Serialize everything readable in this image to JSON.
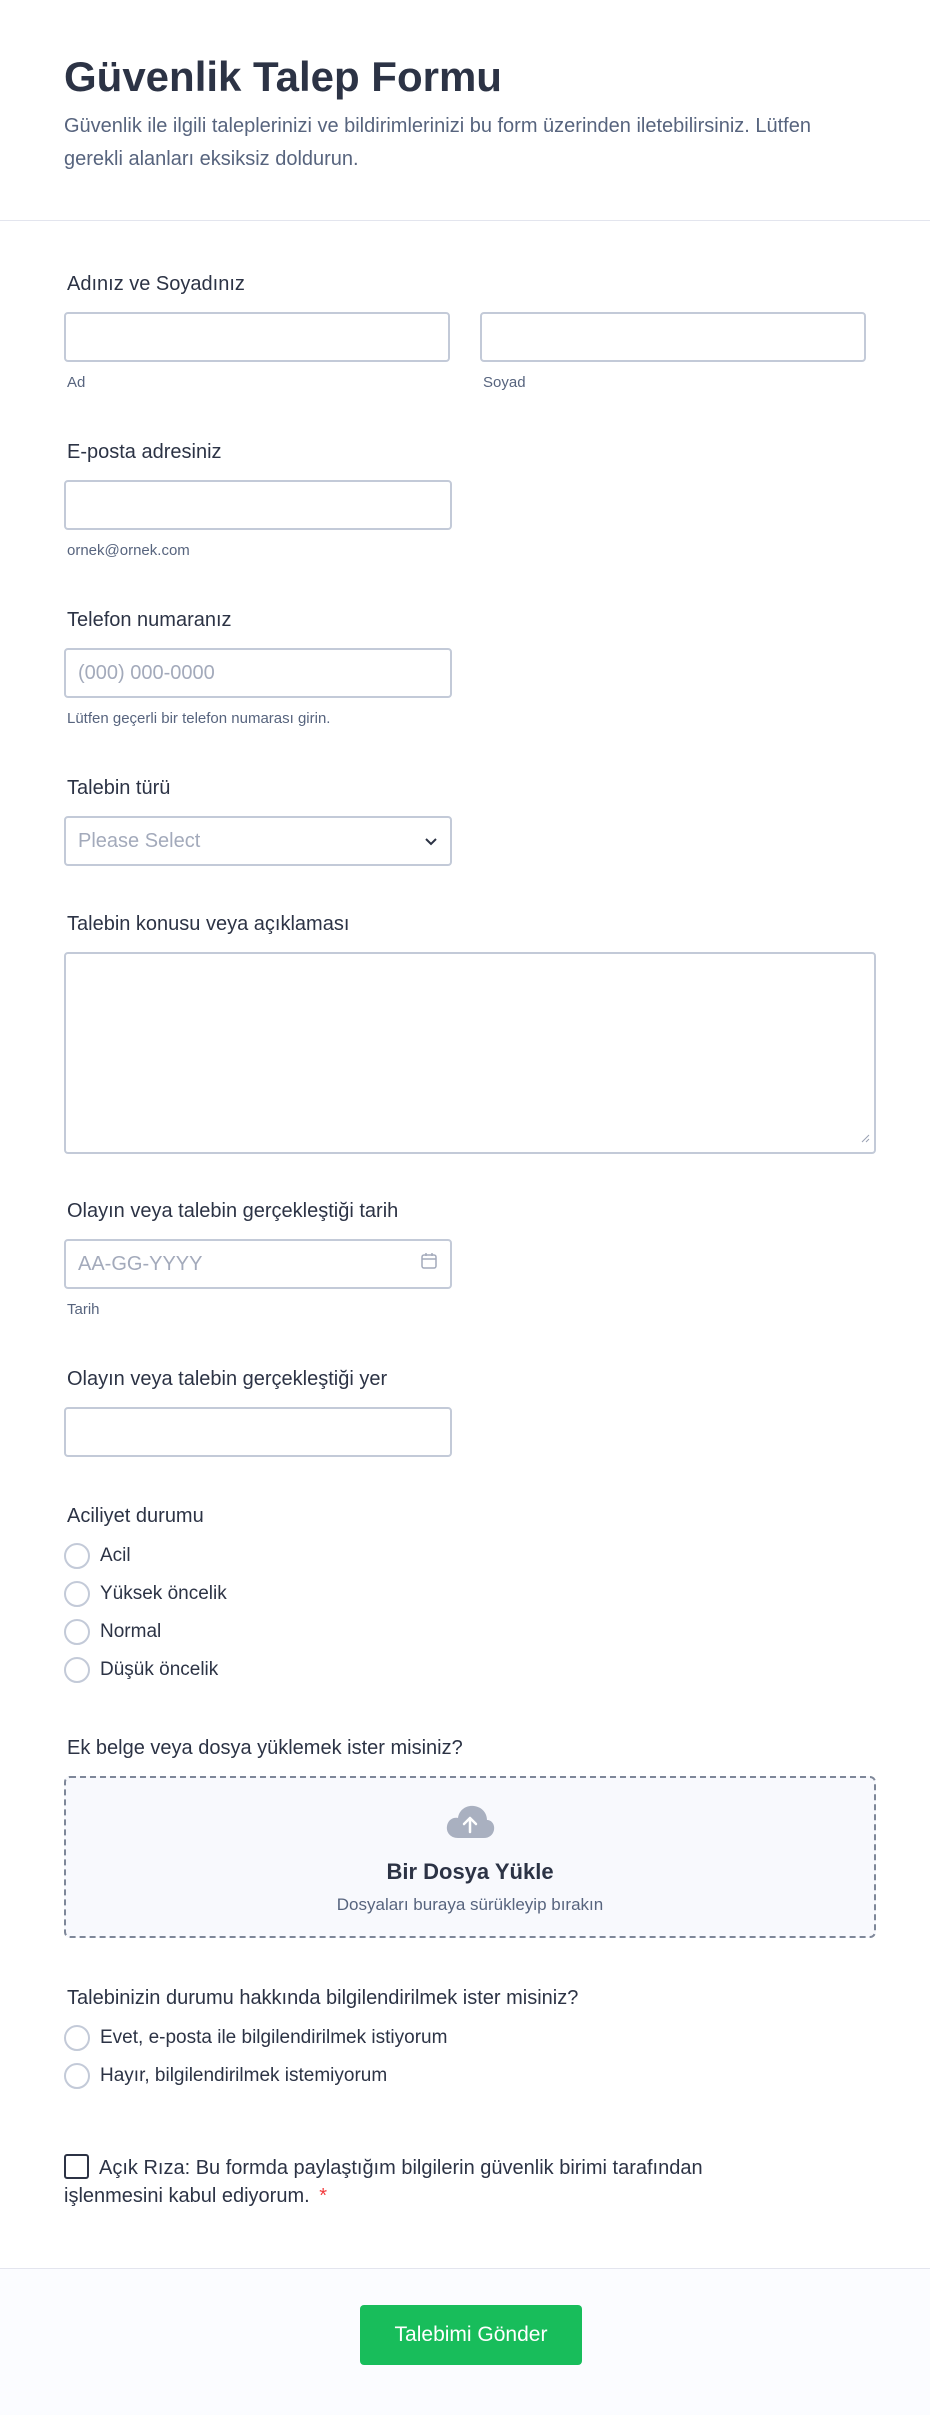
{
  "header": {
    "title": "Güvenlik Talep Formu",
    "description": "Güvenlik ile ilgili taleplerinizi ve bildirimlerinizi bu form üzerinden iletebilirsiniz. Lütfen gerekli alanları eksiksiz doldurun."
  },
  "name": {
    "label": "Adınız ve Soyadınız",
    "first_sub": "Ad",
    "last_sub": "Soyad"
  },
  "email": {
    "label": "E-posta adresiniz",
    "sub": "ornek@ornek.com"
  },
  "phone": {
    "label": "Telefon numaranız",
    "placeholder": "(000) 000-0000",
    "sub": "Lütfen geçerli bir telefon numarası girin."
  },
  "request_type": {
    "label": "Talebin türü",
    "selected": "Please Select"
  },
  "subject": {
    "label": "Talebin konusu veya açıklaması"
  },
  "date": {
    "label": "Olayın veya talebin gerçekleştiği tarih",
    "placeholder": "AA-GG-YYYY",
    "sub": "Tarih"
  },
  "location": {
    "label": "Olayın veya talebin gerçekleştiği yer"
  },
  "urgency": {
    "label": "Aciliyet durumu",
    "options": [
      "Acil",
      "Yüksek öncelik",
      "Normal",
      "Düşük öncelik"
    ]
  },
  "upload": {
    "label": "Ek belge veya dosya yüklemek ister misiniz?",
    "title": "Bir Dosya Yükle",
    "subtitle": "Dosyaları buraya sürükleyip bırakın"
  },
  "notify": {
    "label": "Talebinizin durumu hakkında bilgilendirilmek ister misiniz?",
    "options": [
      "Evet, e-posta ile bilgilendirilmek istiyorum",
      "Hayır, bilgilendirilmek istemiyorum"
    ]
  },
  "consent": {
    "text": "Açık Rıza: Bu formda paylaştığım bilgilerin güvenlik birimi tarafından işlenmesini kabul ediyorum.",
    "required_mark": "*"
  },
  "submit": {
    "label": "Talebimi Gönder"
  },
  "colors": {
    "accent": "#18bd5b",
    "required": "#f23a3c"
  }
}
